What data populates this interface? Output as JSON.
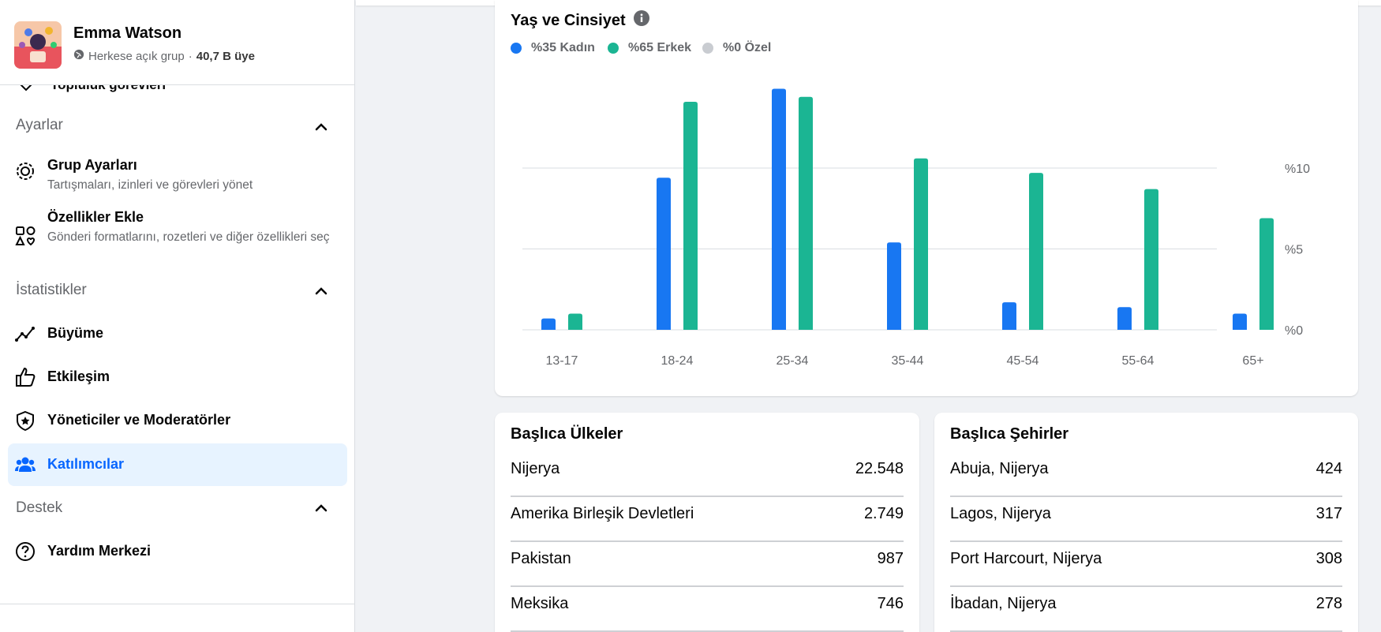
{
  "group": {
    "name": "Emma Watson",
    "privacy": "Herkese açık grup",
    "separator": "·",
    "members": "40,7 B üye"
  },
  "sidebar": {
    "cut_item": "Topluluk görevleri",
    "sections": {
      "settings": "Ayarlar",
      "insights": "İstatistikler",
      "support": "Destek"
    },
    "items": [
      {
        "label": "Grup Ayarları",
        "desc": "Tartışmaları, izinleri ve görevleri yönet",
        "icon": "gear-icon"
      },
      {
        "label": "Özellikler Ekle",
        "desc": "Gönderi formatlarını, rozetleri ve diğer özellikleri seç",
        "icon": "shapes-icon"
      },
      {
        "label": "Büyüme",
        "icon": "growth-icon"
      },
      {
        "label": "Etkileşim",
        "icon": "thumbs-up-icon"
      },
      {
        "label": "Yöneticiler ve Moderatörler",
        "icon": "shield-star-icon"
      },
      {
        "label": "Katılımcılar",
        "icon": "people-icon",
        "active": true
      },
      {
        "label": "Yardım Merkezi",
        "icon": "help-icon"
      }
    ]
  },
  "chart": {
    "title": "Yaş ve Cinsiyet",
    "legend": [
      {
        "label": "%35 Kadın",
        "color": "#1877f2"
      },
      {
        "label": "%65 Erkek",
        "color": "#1bb593"
      },
      {
        "label": "%0 Özel",
        "color": "#c9ccd1"
      }
    ]
  },
  "chart_data": {
    "type": "bar",
    "categories": [
      "13-17",
      "18-24",
      "25-34",
      "35-44",
      "45-54",
      "55-64",
      "65+"
    ],
    "series": [
      {
        "name": "Kadın",
        "color": "#1877f2",
        "values": [
          0.7,
          9.4,
          14.9,
          5.4,
          1.7,
          1.4,
          1.0
        ]
      },
      {
        "name": "Erkek",
        "color": "#1bb593",
        "values": [
          1.0,
          14.1,
          14.4,
          10.6,
          9.7,
          8.7,
          6.9
        ]
      }
    ],
    "y_ticks": [
      "%0",
      "%5",
      "%10"
    ],
    "ylim": [
      0,
      15
    ],
    "grid": true
  },
  "countries": {
    "title": "Başlıca Ülkeler",
    "rows": [
      {
        "name": "Nijerya",
        "value": "22.548"
      },
      {
        "name": "Amerika Birleşik Devletleri",
        "value": "2.749"
      },
      {
        "name": "Pakistan",
        "value": "987"
      },
      {
        "name": "Meksika",
        "value": "746"
      }
    ]
  },
  "cities": {
    "title": "Başlıca Şehirler",
    "rows": [
      {
        "name": "Abuja, Nijerya",
        "value": "424"
      },
      {
        "name": "Lagos, Nijerya",
        "value": "317"
      },
      {
        "name": "Port Harcourt, Nijerya",
        "value": "308"
      },
      {
        "name": "İbadan, Nijerya",
        "value": "278"
      }
    ]
  }
}
